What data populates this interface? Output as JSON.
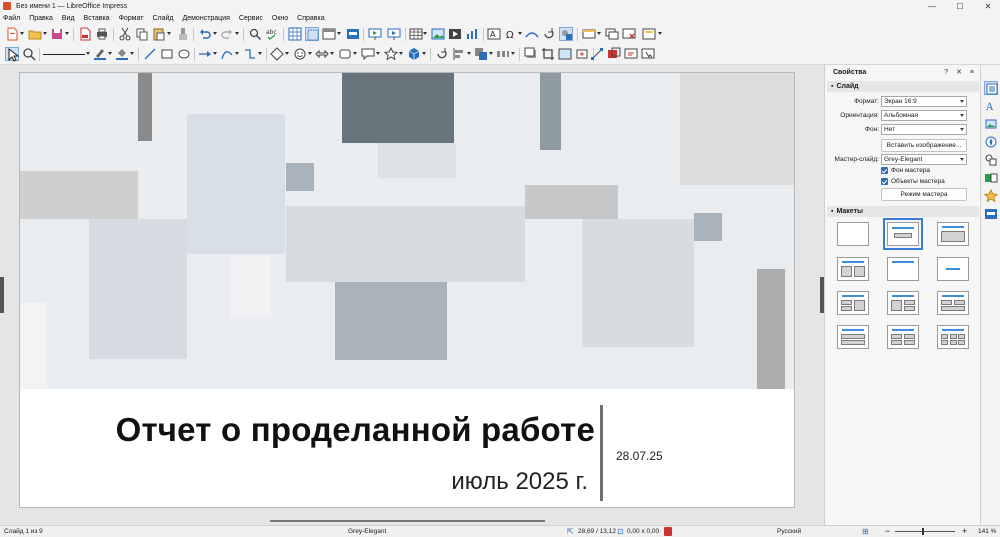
{
  "window": {
    "title": "Без имени 1 — LibreOffice Impress",
    "minimize": "—",
    "maximize": "☐",
    "close": "✕"
  },
  "menu": [
    "Файл",
    "Правка",
    "Вид",
    "Вставка",
    "Формат",
    "Слайд",
    "Демонстрация",
    "Сервис",
    "Окно",
    "Справка"
  ],
  "slide": {
    "title": "Отчет о проделанной работе",
    "subtitle": "июль 2025 г.",
    "date": "28.07.25"
  },
  "sidebar": {
    "title": "Свойства",
    "help": "?",
    "close": "✕",
    "menu": "≡",
    "slide_section": "Слайд",
    "format_label": "Формат:",
    "format_value": "Экран 16:9",
    "orientation_label": "Ориентация:",
    "orientation_value": "Альбомная",
    "background_label": "Фон:",
    "background_value": "Нет",
    "insert_image": "Вставить изображение...",
    "master_label": "Мастер-слайд:",
    "master_value": "Grey-Elegant",
    "master_bg": "Фон мастера",
    "master_objects": "Объекты мастера",
    "master_mode": "Режим мастера",
    "layouts_section": "Макеты"
  },
  "status": {
    "slide": "Слайд 1 из 9",
    "master": "Grey-Elegant",
    "position": "28,69 / 13,12",
    "size": "0,00 x 0,00",
    "language": "Русский",
    "zoom": "141 %",
    "zoom_minus": "−",
    "zoom_plus": "+"
  },
  "colors": {
    "accent": "#3a7bd5",
    "dark_block": "#67747c",
    "divider": "#6f6f6f"
  }
}
